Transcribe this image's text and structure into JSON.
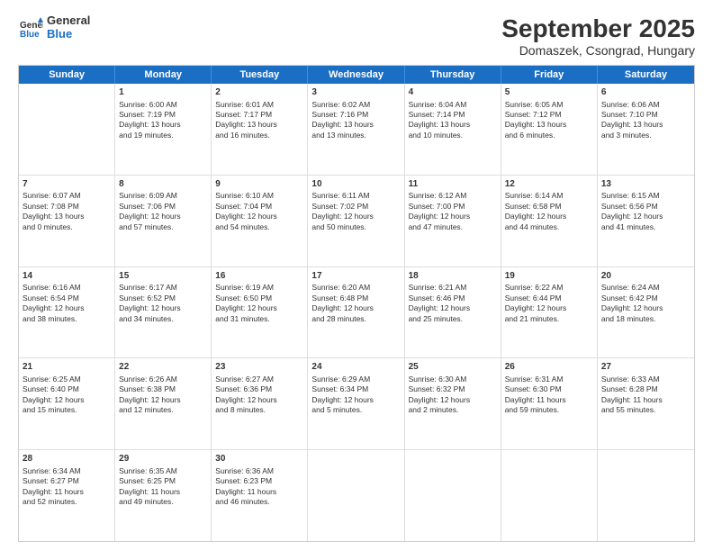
{
  "logo": {
    "general": "General",
    "blue": "Blue"
  },
  "title": "September 2025",
  "subtitle": "Domaszek, Csongrad, Hungary",
  "days": [
    "Sunday",
    "Monday",
    "Tuesday",
    "Wednesday",
    "Thursday",
    "Friday",
    "Saturday"
  ],
  "weeks": [
    [
      {
        "day": "",
        "lines": []
      },
      {
        "day": "1",
        "lines": [
          "Sunrise: 6:00 AM",
          "Sunset: 7:19 PM",
          "Daylight: 13 hours",
          "and 19 minutes."
        ]
      },
      {
        "day": "2",
        "lines": [
          "Sunrise: 6:01 AM",
          "Sunset: 7:17 PM",
          "Daylight: 13 hours",
          "and 16 minutes."
        ]
      },
      {
        "day": "3",
        "lines": [
          "Sunrise: 6:02 AM",
          "Sunset: 7:16 PM",
          "Daylight: 13 hours",
          "and 13 minutes."
        ]
      },
      {
        "day": "4",
        "lines": [
          "Sunrise: 6:04 AM",
          "Sunset: 7:14 PM",
          "Daylight: 13 hours",
          "and 10 minutes."
        ]
      },
      {
        "day": "5",
        "lines": [
          "Sunrise: 6:05 AM",
          "Sunset: 7:12 PM",
          "Daylight: 13 hours",
          "and 6 minutes."
        ]
      },
      {
        "day": "6",
        "lines": [
          "Sunrise: 6:06 AM",
          "Sunset: 7:10 PM",
          "Daylight: 13 hours",
          "and 3 minutes."
        ]
      }
    ],
    [
      {
        "day": "7",
        "lines": [
          "Sunrise: 6:07 AM",
          "Sunset: 7:08 PM",
          "Daylight: 13 hours",
          "and 0 minutes."
        ]
      },
      {
        "day": "8",
        "lines": [
          "Sunrise: 6:09 AM",
          "Sunset: 7:06 PM",
          "Daylight: 12 hours",
          "and 57 minutes."
        ]
      },
      {
        "day": "9",
        "lines": [
          "Sunrise: 6:10 AM",
          "Sunset: 7:04 PM",
          "Daylight: 12 hours",
          "and 54 minutes."
        ]
      },
      {
        "day": "10",
        "lines": [
          "Sunrise: 6:11 AM",
          "Sunset: 7:02 PM",
          "Daylight: 12 hours",
          "and 50 minutes."
        ]
      },
      {
        "day": "11",
        "lines": [
          "Sunrise: 6:12 AM",
          "Sunset: 7:00 PM",
          "Daylight: 12 hours",
          "and 47 minutes."
        ]
      },
      {
        "day": "12",
        "lines": [
          "Sunrise: 6:14 AM",
          "Sunset: 6:58 PM",
          "Daylight: 12 hours",
          "and 44 minutes."
        ]
      },
      {
        "day": "13",
        "lines": [
          "Sunrise: 6:15 AM",
          "Sunset: 6:56 PM",
          "Daylight: 12 hours",
          "and 41 minutes."
        ]
      }
    ],
    [
      {
        "day": "14",
        "lines": [
          "Sunrise: 6:16 AM",
          "Sunset: 6:54 PM",
          "Daylight: 12 hours",
          "and 38 minutes."
        ]
      },
      {
        "day": "15",
        "lines": [
          "Sunrise: 6:17 AM",
          "Sunset: 6:52 PM",
          "Daylight: 12 hours",
          "and 34 minutes."
        ]
      },
      {
        "day": "16",
        "lines": [
          "Sunrise: 6:19 AM",
          "Sunset: 6:50 PM",
          "Daylight: 12 hours",
          "and 31 minutes."
        ]
      },
      {
        "day": "17",
        "lines": [
          "Sunrise: 6:20 AM",
          "Sunset: 6:48 PM",
          "Daylight: 12 hours",
          "and 28 minutes."
        ]
      },
      {
        "day": "18",
        "lines": [
          "Sunrise: 6:21 AM",
          "Sunset: 6:46 PM",
          "Daylight: 12 hours",
          "and 25 minutes."
        ]
      },
      {
        "day": "19",
        "lines": [
          "Sunrise: 6:22 AM",
          "Sunset: 6:44 PM",
          "Daylight: 12 hours",
          "and 21 minutes."
        ]
      },
      {
        "day": "20",
        "lines": [
          "Sunrise: 6:24 AM",
          "Sunset: 6:42 PM",
          "Daylight: 12 hours",
          "and 18 minutes."
        ]
      }
    ],
    [
      {
        "day": "21",
        "lines": [
          "Sunrise: 6:25 AM",
          "Sunset: 6:40 PM",
          "Daylight: 12 hours",
          "and 15 minutes."
        ]
      },
      {
        "day": "22",
        "lines": [
          "Sunrise: 6:26 AM",
          "Sunset: 6:38 PM",
          "Daylight: 12 hours",
          "and 12 minutes."
        ]
      },
      {
        "day": "23",
        "lines": [
          "Sunrise: 6:27 AM",
          "Sunset: 6:36 PM",
          "Daylight: 12 hours",
          "and 8 minutes."
        ]
      },
      {
        "day": "24",
        "lines": [
          "Sunrise: 6:29 AM",
          "Sunset: 6:34 PM",
          "Daylight: 12 hours",
          "and 5 minutes."
        ]
      },
      {
        "day": "25",
        "lines": [
          "Sunrise: 6:30 AM",
          "Sunset: 6:32 PM",
          "Daylight: 12 hours",
          "and 2 minutes."
        ]
      },
      {
        "day": "26",
        "lines": [
          "Sunrise: 6:31 AM",
          "Sunset: 6:30 PM",
          "Daylight: 11 hours",
          "and 59 minutes."
        ]
      },
      {
        "day": "27",
        "lines": [
          "Sunrise: 6:33 AM",
          "Sunset: 6:28 PM",
          "Daylight: 11 hours",
          "and 55 minutes."
        ]
      }
    ],
    [
      {
        "day": "28",
        "lines": [
          "Sunrise: 6:34 AM",
          "Sunset: 6:27 PM",
          "Daylight: 11 hours",
          "and 52 minutes."
        ]
      },
      {
        "day": "29",
        "lines": [
          "Sunrise: 6:35 AM",
          "Sunset: 6:25 PM",
          "Daylight: 11 hours",
          "and 49 minutes."
        ]
      },
      {
        "day": "30",
        "lines": [
          "Sunrise: 6:36 AM",
          "Sunset: 6:23 PM",
          "Daylight: 11 hours",
          "and 46 minutes."
        ]
      },
      {
        "day": "",
        "lines": []
      },
      {
        "day": "",
        "lines": []
      },
      {
        "day": "",
        "lines": []
      },
      {
        "day": "",
        "lines": []
      }
    ]
  ]
}
